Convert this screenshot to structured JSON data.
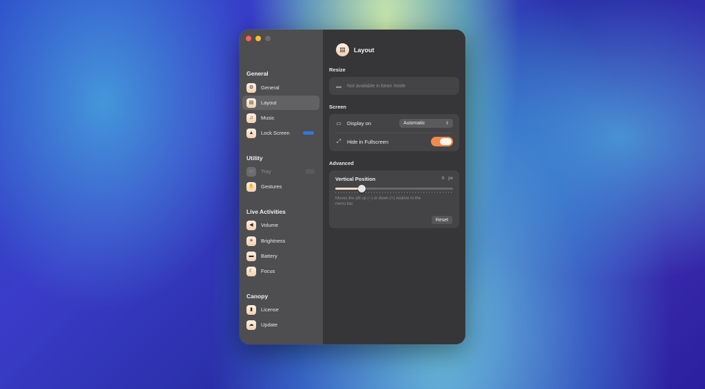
{
  "sidebar": {
    "sections": [
      {
        "title": "General",
        "items": [
          {
            "label": "General",
            "icon": "gear-icon"
          },
          {
            "label": "Layout",
            "icon": "layout-icon",
            "selected": true
          },
          {
            "label": "Music",
            "icon": "music-icon"
          },
          {
            "label": "Lock Screen",
            "icon": "lock-icon",
            "badge": "new"
          }
        ]
      },
      {
        "title": "Utility",
        "items": [
          {
            "label": "Tray",
            "icon": "tray-icon",
            "disabled": true,
            "badge": "soon"
          },
          {
            "label": "Gestures",
            "icon": "hand-icon"
          }
        ]
      },
      {
        "title": "Live Activities",
        "items": [
          {
            "label": "Volume",
            "icon": "speaker-icon"
          },
          {
            "label": "Brightness",
            "icon": "sun-icon"
          },
          {
            "label": "Battery",
            "icon": "battery-icon"
          },
          {
            "label": "Focus",
            "icon": "moon-icon"
          }
        ]
      },
      {
        "title": "Canopy",
        "items": [
          {
            "label": "License",
            "icon": "license-icon"
          },
          {
            "label": "Update",
            "icon": "cloud-icon"
          }
        ]
      }
    ]
  },
  "main": {
    "title": "Layout",
    "resize": {
      "section_label": "Resize",
      "notice": "Not available in bean mode"
    },
    "screen": {
      "section_label": "Screen",
      "display_on_label": "Display on",
      "display_on_value": "Automatic",
      "hide_fullscreen_label": "Hide in Fullscreen",
      "hide_fullscreen_enabled": true
    },
    "advanced": {
      "section_label": "Advanced",
      "vertical_position_label": "Vertical Position",
      "vertical_position_value": "0",
      "vertical_position_unit": "px",
      "slider_fraction": 0.22,
      "help_line1": "Moves the pill up (−) or down (+) relative to the",
      "help_line2": "menu bar.",
      "reset_label": "Reset"
    }
  },
  "colors": {
    "accent": "#f08a4b",
    "badge_blue": "#2e7ae0",
    "icon_fill": "#f4cfae"
  }
}
